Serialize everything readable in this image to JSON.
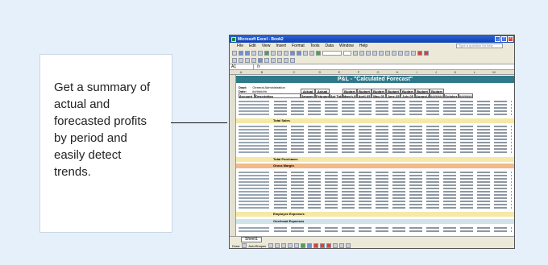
{
  "callout": {
    "text": "Get a summary of actual and forecasted profits by period and easily detect trends."
  },
  "excel": {
    "title": "Microsoft Excel - Book2",
    "menu": [
      "File",
      "Edit",
      "View",
      "Insert",
      "Format",
      "Tools",
      "Data",
      "Window",
      "Help"
    ],
    "help_placeholder": "Type a question for help",
    "name_box": "A1",
    "sheet_title": "P&L - \"Calculated Forecast\"",
    "meta": [
      {
        "key": "Dept:",
        "value": "General Administration"
      },
      {
        "key": "Date:",
        "value": "##/###/##"
      }
    ],
    "column_headers": [
      "Account",
      "Description",
      "Actual",
      "Actual",
      "Act Total",
      "Budget",
      "Budget",
      "Budget",
      "Budget",
      "Budget",
      "Budget",
      "Budget"
    ],
    "period_headers": [
      "January-05",
      "February-05",
      "",
      "March-05",
      "April-05",
      "May-05",
      "June-05",
      "July-05",
      "August-05",
      "########",
      "October-05",
      "########"
    ],
    "bands": {
      "total_sales": "Total Sales",
      "total_purchases": "Total Purchases",
      "gross_margin": "Gross Margin",
      "employee_expenses": "Employee Expenses",
      "overhead_expenses": "Overhead Expenses"
    },
    "sheet_tab": "Sheet1",
    "draw_label": "Draw",
    "autoshapes_label": "AutoShapes"
  }
}
